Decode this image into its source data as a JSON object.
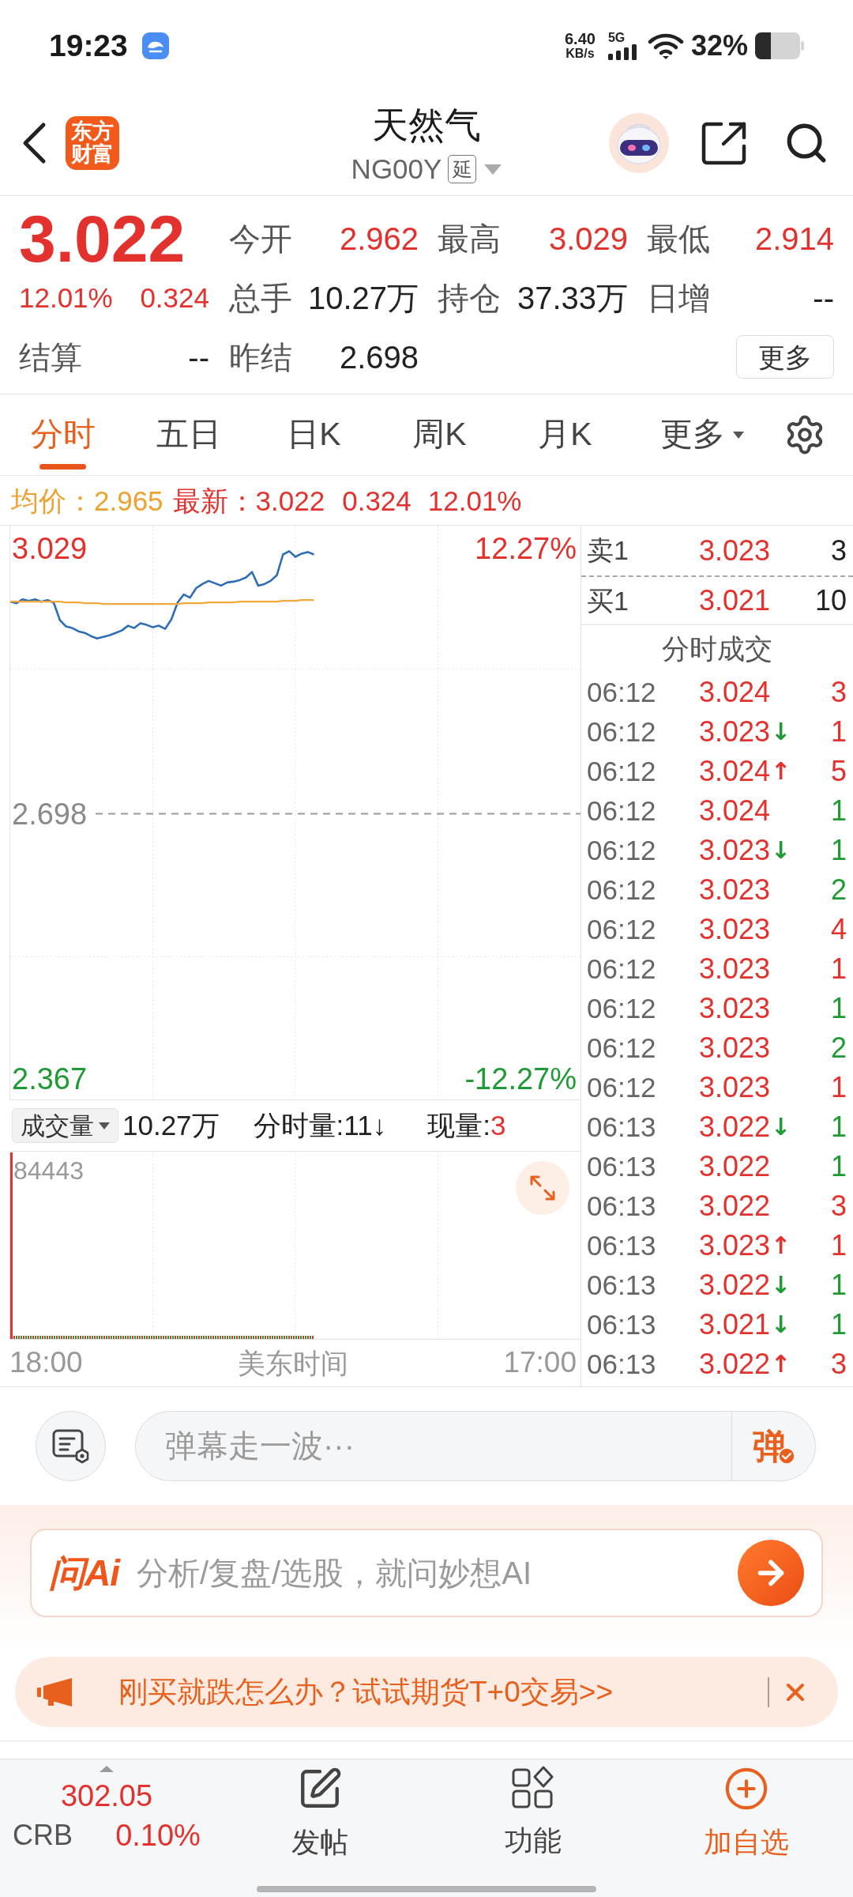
{
  "status_bar": {
    "time": "19:23",
    "net_speed": "6.40",
    "net_speed_unit": "KB/s",
    "network": "5G",
    "battery": "32%"
  },
  "header": {
    "logo": "东方财富",
    "title": "天然气",
    "code": "NG00Y",
    "delay_badge": "延"
  },
  "quote": {
    "price": "3.022",
    "change_pct": "12.01%",
    "change": "0.324",
    "settlement": {
      "label": "结算",
      "value": "--"
    },
    "stats": [
      {
        "label": "今开",
        "value": "2.962",
        "color": "#e3312d"
      },
      {
        "label": "最高",
        "value": "3.029",
        "color": "#e3312d"
      },
      {
        "label": "最低",
        "value": "2.914",
        "color": "#e3312d"
      },
      {
        "label": "总手",
        "value": "10.27万",
        "color": "#222222"
      },
      {
        "label": "持仓",
        "value": "37.33万",
        "color": "#222222"
      },
      {
        "label": "日增",
        "value": "--",
        "color": "#222222"
      },
      {
        "label": "昨结",
        "value": "2.698",
        "color": "#222222"
      }
    ],
    "more_button": "更多"
  },
  "tabs": [
    {
      "label": "分时",
      "selected": true
    },
    {
      "label": "五日",
      "selected": false
    },
    {
      "label": "日K",
      "selected": false
    },
    {
      "label": "周K",
      "selected": false
    },
    {
      "label": "月K",
      "selected": false
    }
  ],
  "more_tab": "更多",
  "legend": {
    "average": "均价：2.965",
    "latest": "最新：3.022",
    "change": "0.324",
    "change_pct": "12.01%"
  },
  "price_chart": {
    "right_labels": [
      "12.27%",
      "-12.27%"
    ],
    "chart_data": {
      "type": "line",
      "categories": [
        null,
        null,
        null,
        null,
        null,
        null,
        null,
        null,
        null,
        null,
        null,
        null,
        null,
        null,
        null,
        null,
        null,
        null,
        null,
        null,
        null,
        null,
        null,
        null,
        null,
        null,
        null,
        null,
        null,
        null,
        null,
        null,
        null,
        null,
        null,
        null,
        null,
        null,
        null,
        null,
        null,
        null,
        null,
        null,
        null,
        null,
        null,
        null,
        null,
        null,
        null,
        null,
        null,
        null,
        null,
        null,
        null,
        null,
        null,
        null,
        null,
        null,
        null,
        null,
        null,
        null,
        null,
        null,
        null,
        null,
        null,
        null,
        null,
        null,
        null,
        null,
        null,
        null,
        null,
        null,
        null,
        null,
        null,
        null,
        null,
        null,
        null,
        null,
        null,
        null,
        null,
        null,
        null
      ],
      "series": [
        {
          "color": "#2f6db5",
          "values": [
            2.963,
            2.961,
            2.966,
            2.964,
            2.966,
            2.963,
            2.965,
            2.962,
            2.94,
            2.932,
            2.93,
            2.926,
            2.924,
            2.92,
            2.917,
            2.919,
            2.921,
            2.924,
            2.927,
            2.933,
            2.93,
            2.936,
            2.934,
            2.931,
            2.933,
            2.929,
            2.941,
            2.962,
            2.972,
            2.968,
            2.98,
            2.985,
            2.989,
            2.986,
            2.983,
            2.987,
            2.988,
            2.99,
            2.993,
            3.0,
            2.983,
            2.985,
            2.989,
            2.996,
            3.022,
            3.026,
            3.019,
            3.023,
            3.025,
            3.022,
            null,
            null,
            null,
            null,
            null,
            null,
            null,
            null,
            null,
            null,
            null,
            null,
            null,
            null,
            null,
            null,
            null,
            null,
            null,
            null,
            null,
            null,
            null,
            null,
            null,
            null,
            null,
            null,
            null,
            null,
            null,
            null,
            null,
            null,
            null,
            null,
            null,
            null,
            null,
            null,
            null,
            null,
            null
          ]
        },
        {
          "color": "#f0a93a",
          "values": [
            2.963,
            2.963,
            2.963,
            2.963,
            2.963,
            2.963,
            2.963,
            2.963,
            2.963,
            2.962,
            2.962,
            2.962,
            2.961,
            2.961,
            2.961,
            2.96,
            2.96,
            2.96,
            2.96,
            2.96,
            2.96,
            2.96,
            2.96,
            2.96,
            2.96,
            2.96,
            2.96,
            2.96,
            2.961,
            2.961,
            2.961,
            2.961,
            2.962,
            2.962,
            2.962,
            2.962,
            2.962,
            2.963,
            2.963,
            2.963,
            2.963,
            2.963,
            2.963,
            2.963,
            2.964,
            2.964,
            2.964,
            2.965,
            2.965,
            2.965,
            null,
            null,
            null,
            null,
            null,
            null,
            null,
            null,
            null,
            null,
            null,
            null,
            null,
            null,
            null,
            null,
            null,
            null,
            null,
            null,
            null,
            null,
            null,
            null,
            null,
            null,
            null,
            null,
            null,
            null,
            null,
            null,
            null,
            null,
            null,
            null,
            null,
            null,
            null,
            null,
            null,
            null,
            null
          ]
        }
      ],
      "ylim": [
        2.34,
        3.058
      ],
      "yticks": [
        {
          "value": 3.029,
          "label": "3.029"
        },
        {
          "value": 2.698,
          "label": "2.698"
        },
        {
          "value": 2.367,
          "label": "2.367"
        }
      ],
      "grid": true,
      "ref_lines": [
        {
          "axis": "y",
          "value": 2.698
        }
      ]
    }
  },
  "volume": {
    "dropdown": "成交量",
    "total": "10.27万",
    "minute_volume": "分时量:11↓",
    "current_label": "现量:",
    "current_value": "3",
    "max_label": "84443"
  },
  "time_axis": {
    "start": "18:00",
    "title": "美东时间",
    "end": "17:00"
  },
  "order_book": [
    {
      "label": "卖1",
      "price": "3.023",
      "volume": "3"
    },
    {
      "label": "买1",
      "price": "3.021",
      "volume": "10"
    }
  ],
  "trades_title": "分时成交",
  "trades": [
    {
      "time": "06:12",
      "price": "3.024",
      "volume": "3",
      "color": "#e3312d"
    },
    {
      "time": "06:12",
      "price": "3.023",
      "arrow": {
        "symbol": "↓",
        "color": "#1f9a34"
      },
      "volume": "1",
      "color": "#e3312d"
    },
    {
      "time": "06:12",
      "price": "3.024",
      "arrow": {
        "symbol": "↑",
        "color": "#e3312d"
      },
      "volume": "5",
      "color": "#e3312d"
    },
    {
      "time": "06:12",
      "price": "3.024",
      "volume": "1",
      "color": "#1f9a34"
    },
    {
      "time": "06:12",
      "price": "3.023",
      "arrow": {
        "symbol": "↓",
        "color": "#1f9a34"
      },
      "volume": "1",
      "color": "#1f9a34"
    },
    {
      "time": "06:12",
      "price": "3.023",
      "volume": "2",
      "color": "#1f9a34"
    },
    {
      "time": "06:12",
      "price": "3.023",
      "volume": "4",
      "color": "#e3312d"
    },
    {
      "time": "06:12",
      "price": "3.023",
      "volume": "1",
      "color": "#e3312d"
    },
    {
      "time": "06:12",
      "price": "3.023",
      "volume": "1",
      "color": "#1f9a34"
    },
    {
      "time": "06:12",
      "price": "3.023",
      "volume": "2",
      "color": "#1f9a34"
    },
    {
      "time": "06:12",
      "price": "3.023",
      "volume": "1",
      "color": "#e3312d"
    },
    {
      "time": "06:13",
      "price": "3.022",
      "arrow": {
        "symbol": "↓",
        "color": "#1f9a34"
      },
      "volume": "1",
      "color": "#1f9a34"
    },
    {
      "time": "06:13",
      "price": "3.022",
      "volume": "1",
      "color": "#1f9a34"
    },
    {
      "time": "06:13",
      "price": "3.022",
      "volume": "3",
      "color": "#e3312d"
    },
    {
      "time": "06:13",
      "price": "3.023",
      "arrow": {
        "symbol": "↑",
        "color": "#e3312d"
      },
      "volume": "1",
      "color": "#e3312d"
    },
    {
      "time": "06:13",
      "price": "3.022",
      "arrow": {
        "symbol": "↓",
        "color": "#1f9a34"
      },
      "volume": "1",
      "color": "#1f9a34"
    },
    {
      "time": "06:13",
      "price": "3.021",
      "arrow": {
        "symbol": "↓",
        "color": "#1f9a34"
      },
      "volume": "1",
      "color": "#1f9a34"
    },
    {
      "time": "06:13",
      "price": "3.022",
      "arrow": {
        "symbol": "↑",
        "color": "#e3312d"
      },
      "volume": "3",
      "color": "#e3312d"
    }
  ],
  "danmaku": {
    "placeholder": "弹幕走一波···",
    "send_button": "弹"
  },
  "ai_bar": {
    "logo": "问Ai",
    "placeholder": "分析/复盘/选股，就问妙想AI"
  },
  "promo": {
    "text": "刚买就跌怎么办？试试期货T+0交易>>"
  },
  "bottom_nav": {
    "index": {
      "value": "302.05",
      "name": "CRB",
      "change": "0.10%"
    },
    "items": [
      {
        "kind": "post",
        "label": "发帖"
      },
      {
        "kind": "apps",
        "label": "功能"
      },
      {
        "kind": "add",
        "label": "加自选"
      }
    ]
  }
}
